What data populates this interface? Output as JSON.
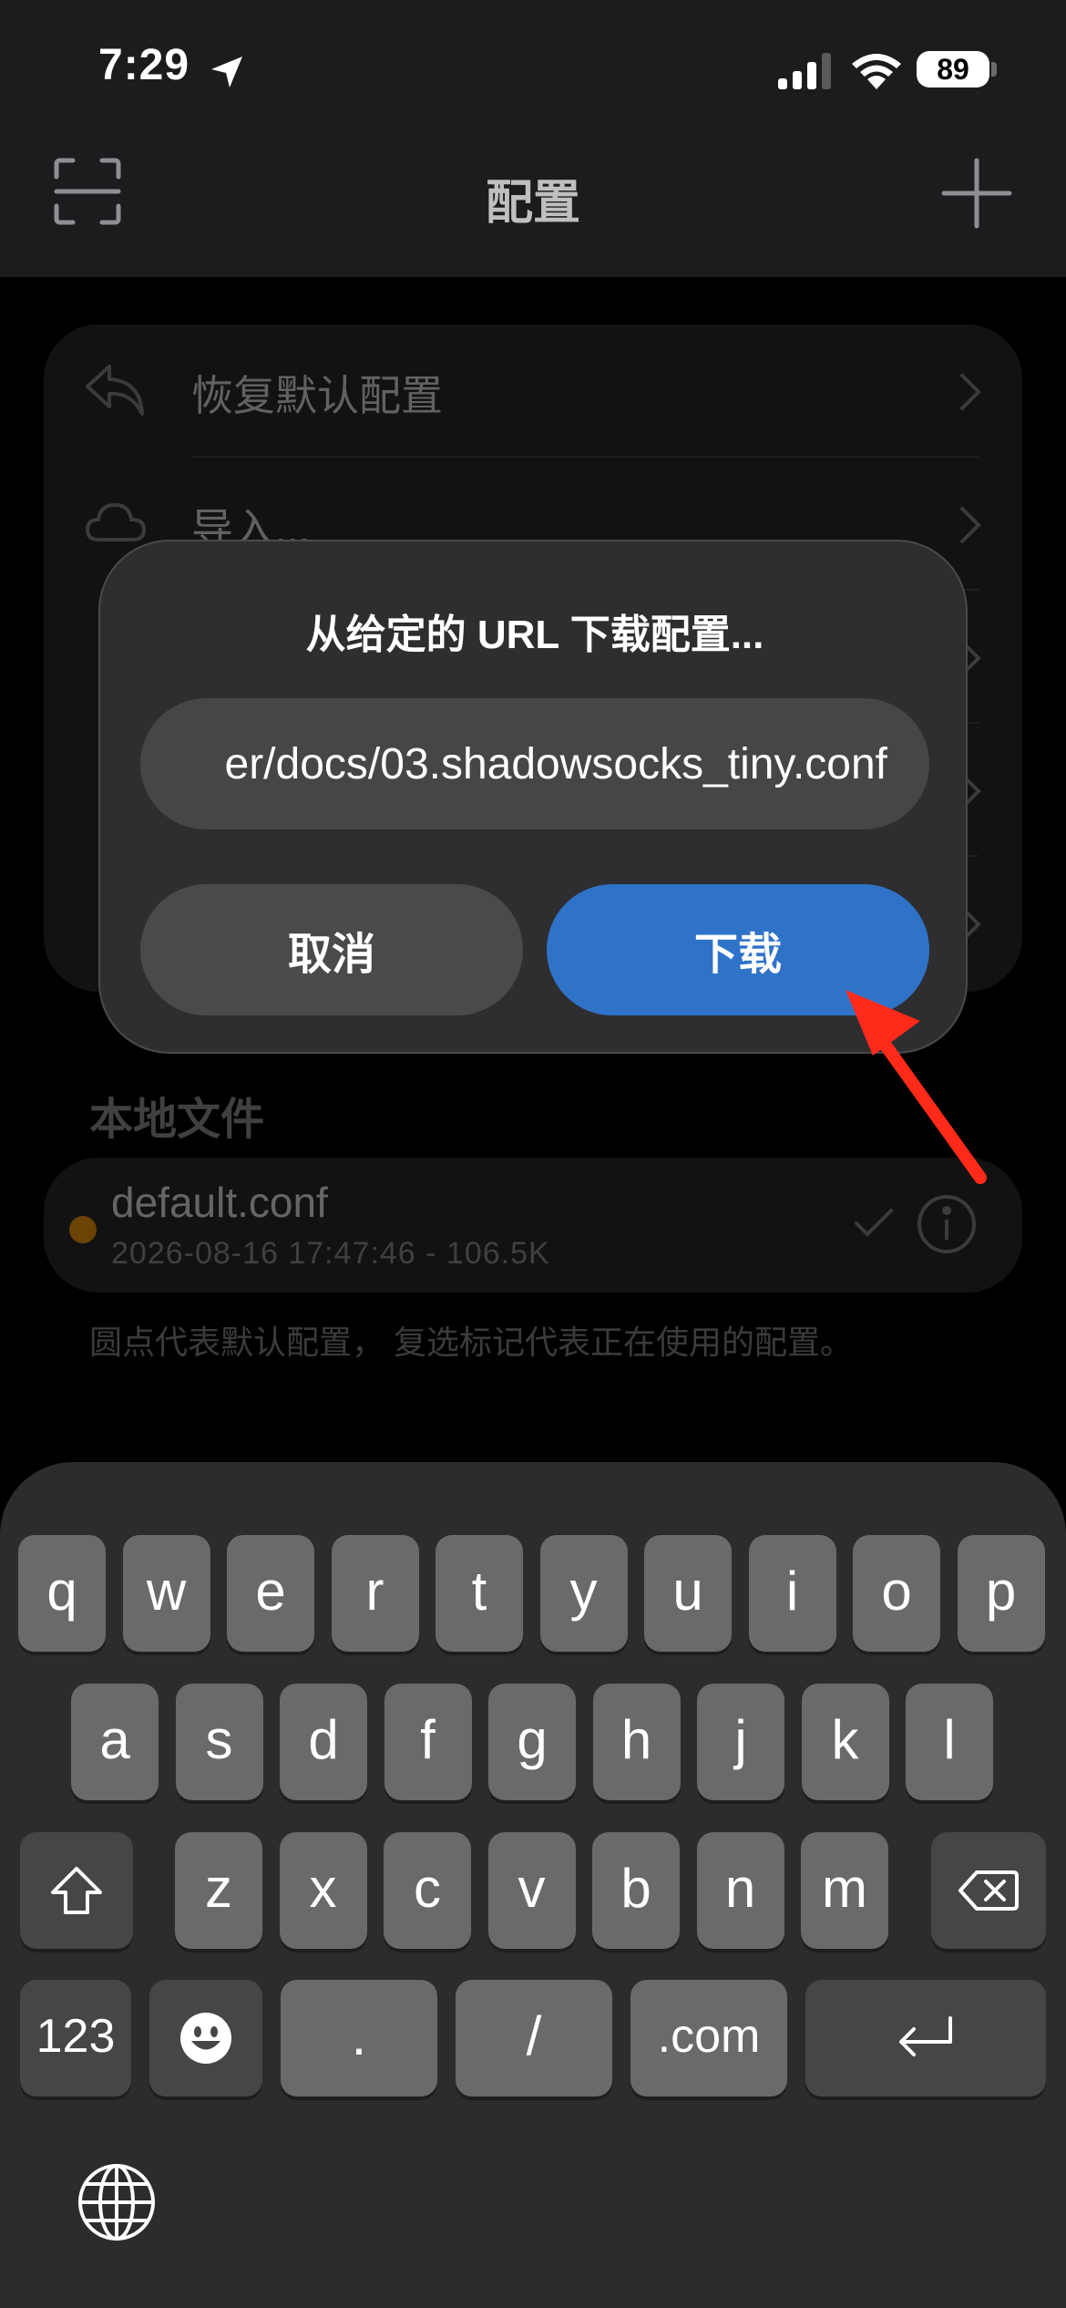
{
  "status": {
    "time": "7:29",
    "battery": "89"
  },
  "nav": {
    "title": "配置"
  },
  "menu": {
    "items": [
      {
        "label": "恢复默认配置",
        "icon": "undo-icon"
      },
      {
        "label": "导入...",
        "icon": "cloud-icon"
      }
    ]
  },
  "local_files": {
    "section_title": "本地文件",
    "files": [
      {
        "name": "default.conf",
        "meta": "2026-08-16 17:47:46 - 106.5K"
      }
    ],
    "footnote": "圆点代表默认配置， 复选标记代表正在使用的配置。"
  },
  "alert": {
    "title": "从给定的 URL 下载配置...",
    "input_value": "er/docs/03.shadowsocks_tiny.conf",
    "cancel_label": "取消",
    "download_label": "下载"
  },
  "keyboard": {
    "row1": [
      "q",
      "w",
      "e",
      "r",
      "t",
      "y",
      "u",
      "i",
      "o",
      "p"
    ],
    "row2": [
      "a",
      "s",
      "d",
      "f",
      "g",
      "h",
      "j",
      "k",
      "l"
    ],
    "row3": [
      "z",
      "x",
      "c",
      "v",
      "b",
      "n",
      "m"
    ],
    "row4": {
      "numbers": "123",
      "dot": ".",
      "slash": "/",
      "dotcom": ".com"
    }
  },
  "colors": {
    "accent": "#2f73c8",
    "default_dot": "#ff9f0a",
    "annotation": "#ff2a1a"
  }
}
